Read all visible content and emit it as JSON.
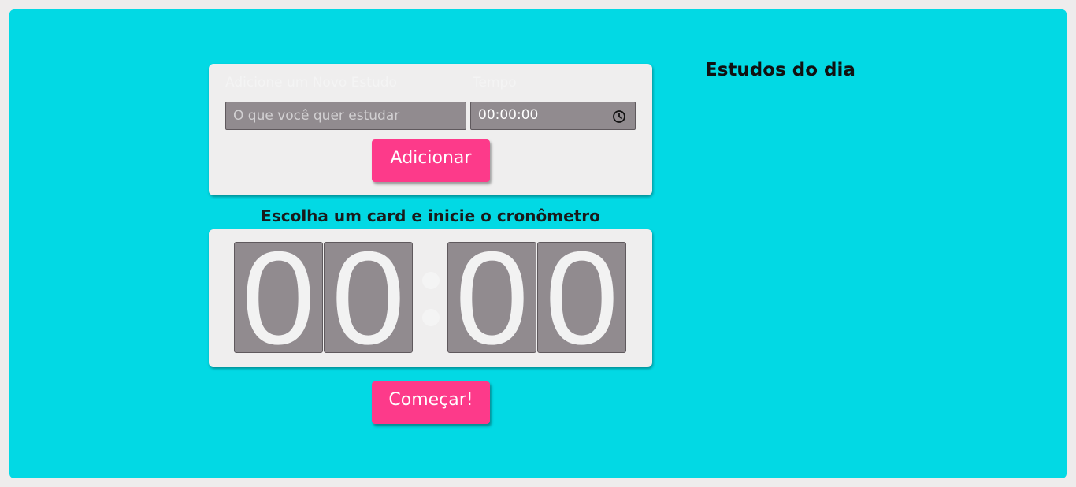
{
  "form": {
    "task_label": "Adicione um Novo Estudo",
    "time_label": "Tempo",
    "task_placeholder": "O que você quer estudar",
    "time_value": "00:00:00",
    "add_button": "Adicionar"
  },
  "timer": {
    "heading": "Escolha um card e inicie o cronômetro",
    "digits": [
      "0",
      "0",
      "0",
      "0"
    ],
    "start_button": "Começar!"
  },
  "sidebar": {
    "title": "Estudos do dia"
  },
  "icons": {
    "time_field": "clock-icon"
  },
  "colors": {
    "background": "#02d9e4",
    "card": "#efeeee",
    "accent": "#fd3a8a",
    "input": "#918b8f"
  }
}
